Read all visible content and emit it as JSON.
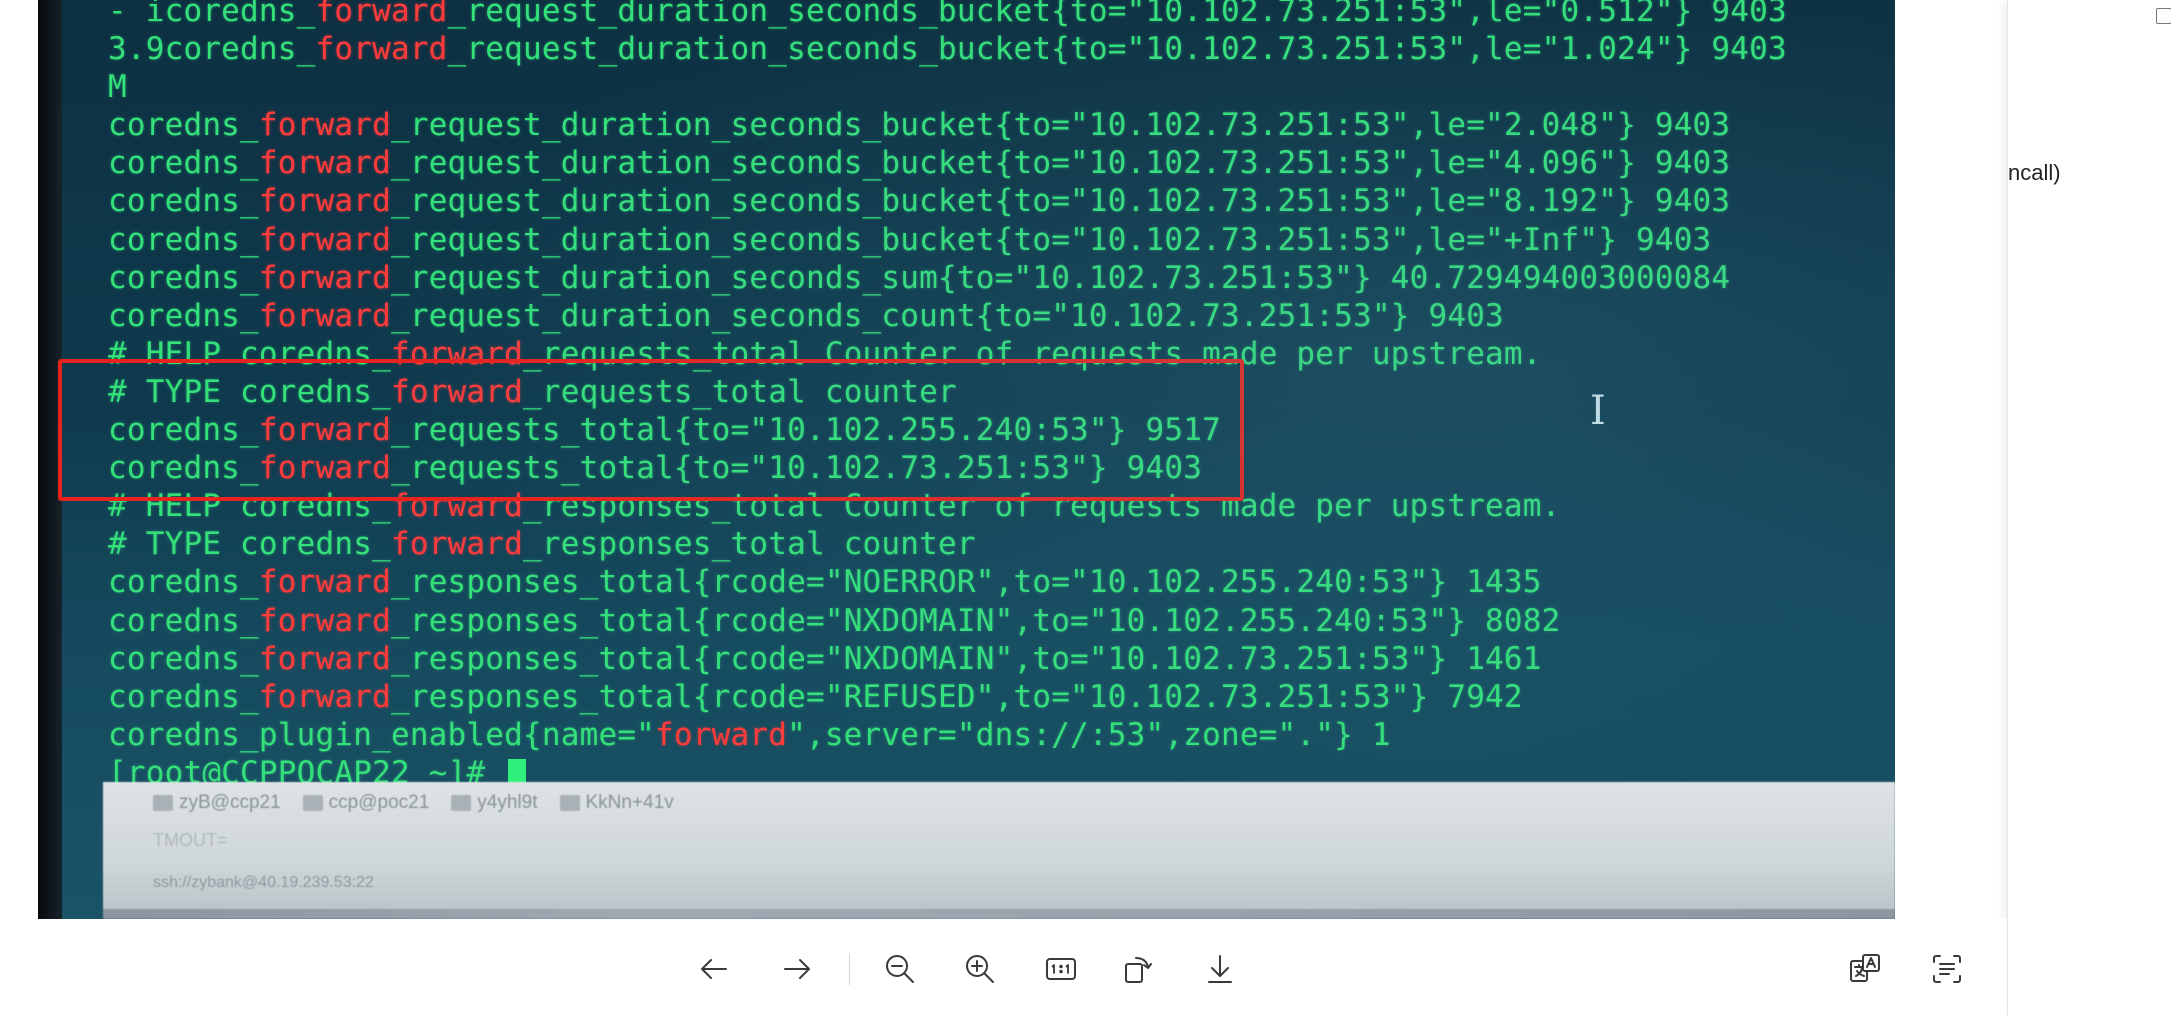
{
  "terminal": {
    "lines": [
      [
        {
          "t": "- icoredns_"
        },
        {
          "t": "forward",
          "hl": true
        },
        {
          "t": "_request_duration_seconds_bucket{to=\"10.102.73.251:53\",le=\"0.512\"} 9403"
        }
      ],
      [
        {
          "t": "3.9coredns_"
        },
        {
          "t": "forward",
          "hl": true
        },
        {
          "t": "_request_duration_seconds_bucket{to=\"10.102.73.251:53\",le=\"1.024\"} 9403"
        }
      ],
      [
        {
          "t": "M"
        }
      ],
      [
        {
          "t": "coredns_"
        },
        {
          "t": "forward",
          "hl": true
        },
        {
          "t": "_request_duration_seconds_bucket{to=\"10.102.73.251:53\",le=\"2.048\"} 9403"
        }
      ],
      [
        {
          "t": "coredns_"
        },
        {
          "t": "forward",
          "hl": true
        },
        {
          "t": "_request_duration_seconds_bucket{to=\"10.102.73.251:53\",le=\"4.096\"} 9403"
        }
      ],
      [
        {
          "t": "coredns_"
        },
        {
          "t": "forward",
          "hl": true
        },
        {
          "t": "_request_duration_seconds_bucket{to=\"10.102.73.251:53\",le=\"8.192\"} 9403"
        }
      ],
      [
        {
          "t": "coredns_"
        },
        {
          "t": "forward",
          "hl": true
        },
        {
          "t": "_request_duration_seconds_bucket{to=\"10.102.73.251:53\",le=\"+Inf\"} 9403"
        }
      ],
      [
        {
          "t": "coredns_"
        },
        {
          "t": "forward",
          "hl": true
        },
        {
          "t": "_request_duration_seconds_sum{to=\"10.102.73.251:53\"} 40.729494003000084"
        }
      ],
      [
        {
          "t": "coredns_"
        },
        {
          "t": "forward",
          "hl": true
        },
        {
          "t": "_request_duration_seconds_count{to=\"10.102.73.251:53\"} 9403"
        }
      ],
      [
        {
          "t": "# HELP coredns_"
        },
        {
          "t": "forward",
          "hl": true
        },
        {
          "t": "_requests_total Counter of requests made per upstream."
        }
      ],
      [
        {
          "t": "# TYPE coredns_"
        },
        {
          "t": "forward",
          "hl": true
        },
        {
          "t": "_requests_total counter"
        }
      ],
      [
        {
          "t": "coredns_"
        },
        {
          "t": "forward",
          "hl": true
        },
        {
          "t": "_requests_total{to=\"10.102.255.240:53\"} 9517"
        }
      ],
      [
        {
          "t": "coredns_"
        },
        {
          "t": "forward",
          "hl": true
        },
        {
          "t": "_requests_total{to=\"10.102.73.251:53\"} 9403"
        }
      ],
      [
        {
          "t": "# HELP coredns_"
        },
        {
          "t": "forward",
          "hl": true
        },
        {
          "t": "_responses_total Counter of requests made per upstream."
        }
      ],
      [
        {
          "t": "# TYPE coredns_"
        },
        {
          "t": "forward",
          "hl": true
        },
        {
          "t": "_responses_total counter"
        }
      ],
      [
        {
          "t": "coredns_"
        },
        {
          "t": "forward",
          "hl": true
        },
        {
          "t": "_responses_total{rcode=\"NOERROR\",to=\"10.102.255.240:53\"} 1435"
        }
      ],
      [
        {
          "t": "coredns_"
        },
        {
          "t": "forward",
          "hl": true
        },
        {
          "t": "_responses_total{rcode=\"NXDOMAIN\",to=\"10.102.255.240:53\"} 8082"
        }
      ],
      [
        {
          "t": "coredns_"
        },
        {
          "t": "forward",
          "hl": true
        },
        {
          "t": "_responses_total{rcode=\"NXDOMAIN\",to=\"10.102.73.251:53\"} 1461"
        }
      ],
      [
        {
          "t": "coredns_"
        },
        {
          "t": "forward",
          "hl": true
        },
        {
          "t": "_responses_total{rcode=\"REFUSED\",to=\"10.102.73.251:53\"} 7942"
        }
      ],
      [
        {
          "t": "coredns_plugin_enabled{name=\""
        },
        {
          "t": "forward",
          "hl": true
        },
        {
          "t": "\",server=\"dns://:53\",zone=\".\"} 1"
        }
      ],
      [
        {
          "t": "[root@CCPPOCAP22 ~]# "
        },
        {
          "cursor": true
        }
      ]
    ],
    "highlight_color": "#e8231f"
  },
  "window_strip": {
    "tabs": [
      "zyB@ccp21",
      "ccp@poc21",
      "y4yhl9t",
      "KkNn+41v"
    ],
    "sub_label": "TMOUT=",
    "status": "ssh://zybank@40.19.239.53:22"
  },
  "side_panel": {
    "snippet_text": "ncall)"
  },
  "toolbar": {
    "buttons": [
      {
        "name": "back-button",
        "icon": "arrow-left-icon"
      },
      {
        "name": "forward-button",
        "icon": "arrow-right-icon"
      },
      {
        "name": "zoom-out-button",
        "icon": "zoom-out-icon"
      },
      {
        "name": "zoom-in-button",
        "icon": "zoom-in-icon"
      },
      {
        "name": "actual-size-button",
        "icon": "one-to-one-icon",
        "label": "1:1"
      },
      {
        "name": "rotate-button",
        "icon": "rotate-icon"
      },
      {
        "name": "download-button",
        "icon": "download-icon"
      },
      {
        "name": "translate-button",
        "icon": "translate-icon"
      },
      {
        "name": "extract-text-button",
        "icon": "extract-text-icon"
      }
    ]
  }
}
